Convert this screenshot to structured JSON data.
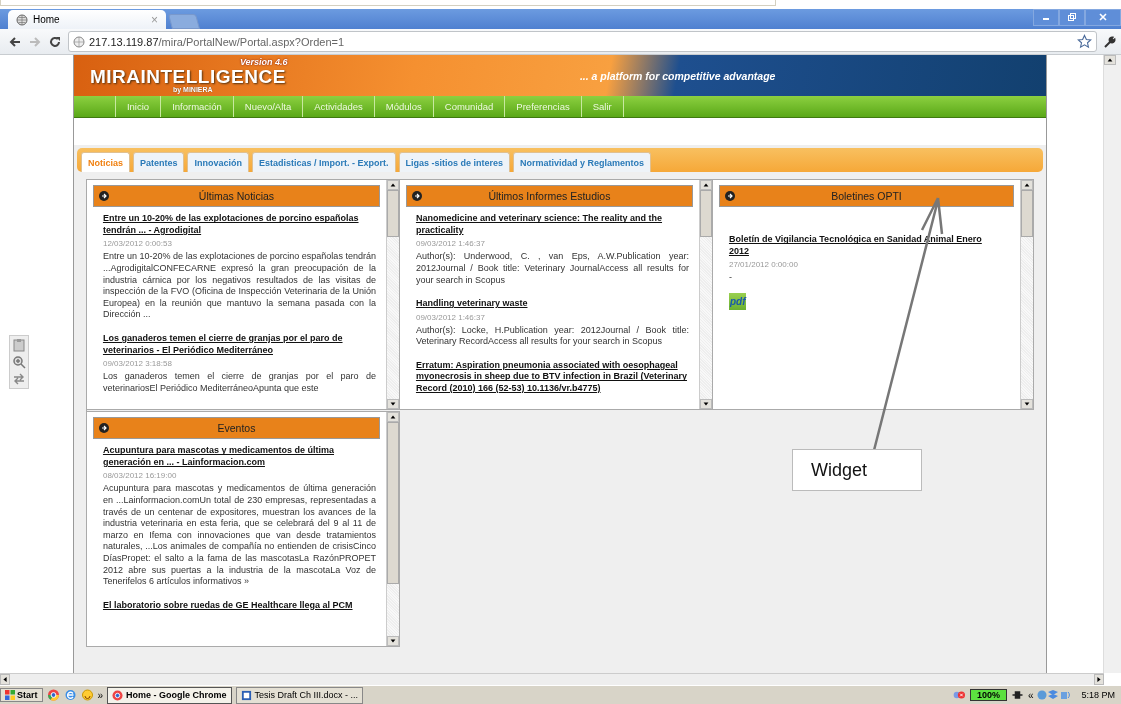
{
  "browser": {
    "tabs": [
      {
        "title": "Home",
        "selected": true
      }
    ],
    "close": "×",
    "url_host": "217.13.119.87",
    "url_path": "/mira/PortalNew/Portal.aspx?Orden=1"
  },
  "site": {
    "logo": "MIRAINTELLIGENCE",
    "version": "Version 4.6",
    "byline": "by MINIERA",
    "tagline": "... a platform for competitive advantage",
    "nav": [
      "Inicio",
      "Información",
      "Nuevo/Alta",
      "Actividades",
      "Módulos",
      "Comunidad",
      "Preferencias",
      "Salir"
    ]
  },
  "tabs": [
    {
      "label": "Noticias",
      "selected": true
    },
    {
      "label": "Patentes",
      "selected": false
    },
    {
      "label": "Innovación",
      "selected": false
    },
    {
      "label": "Estadisticas / Import. - Export.",
      "selected": false
    },
    {
      "label": "Ligas -sitios de interes",
      "selected": false
    },
    {
      "label": "Normatividad y Reglamentos",
      "selected": false
    }
  ],
  "columns": [
    {
      "widgets": [
        {
          "title": "Últimas Noticias",
          "items": [
            {
              "title": "Entre un 10-20% de las explotaciones de porcino españolas tendrán ... - Agrodigital",
              "date": "12/03/2012 0:00:53",
              "body": "Entre un 10-20% de las explotaciones de porcino españolas tendrán ...AgrodigitalCONFECARNE expresó la gran preocupación de la industria cárnica por los negativos resultados de las visitas de inspección de la FVO (Oficina de Inspección Veterinaria de la Unión Europea) en la reunión que mantuvo la semana pasada con la Dirección ..."
            },
            {
              "title": "Los ganaderos temen el cierre de granjas por el paro de veterinarios - El Periódico Mediterráneo",
              "date": "09/03/2012 3:18:58",
              "body": "Los ganaderos temen el cierre de granjas por el paro de veterinariosEl Periódico MediterráneoApunta que este"
            }
          ]
        },
        {
          "title": "Eventos",
          "items": [
            {
              "title": "Acupuntura para mascotas y medicamentos de última generación en ... - Lainformacion.com",
              "date": "08/03/2012 16:19:00",
              "body": "Acupuntura para mascotas y medicamentos de última generación en ...Lainformacion.comUn total de 230 empresas, representadas a través de un centenar de expositores, muestran los avances de la industria veterinaria en esta feria, que se celebrará del 9 al 11 de marzo en Ifema con innovaciones que van desde tratamientos naturales, ...Los animales de compañía no entienden de crisisCinco DíasPropet: el salto a la fama de las mascotasLa RazónPROPET 2012 abre sus puertas a la industria de la mascotaLa Voz de Tenerifelos 6 artículos informativos »"
            },
            {
              "title": "El laboratorio sobre ruedas de GE Healthcare llega al PCM"
            }
          ]
        }
      ]
    },
    {
      "widgets": [
        {
          "title": "Últimos Informes Estudios",
          "items": [
            {
              "title": "Nanomedicine and veterinary science: The reality and the practicality",
              "date": "09/03/2012 1:46:37",
              "body": "Author(s): Underwood, C. , van Eps, A.W.Publication year: 2012Journal / Book title: Veterinary JournalAccess all results for your search in Scopus"
            },
            {
              "title": "Handling veterinary waste",
              "date": "09/03/2012 1:46:37",
              "body": "Author(s): Locke, H.Publication year: 2012Journal / Book title: Veterinary RecordAccess all results for your search in Scopus"
            },
            {
              "title": "Erratum: Aspiration pneumonia associated with oesophageal myonecrosis in sheep due to BTV infection in Brazil (Veterinary Record (2010) 166 (52-53) 10.1136/vr.b4775)"
            }
          ]
        }
      ]
    },
    {
      "widgets": [
        {
          "title": "Boletines OPTI",
          "items": [
            {
              "title": "Boletín de Vigilancia Tecnológica en Sanidad Animal Enero 2012",
              "date": "27/01/2012 0:00:00",
              "body": "-",
              "attachment": "pdf"
            }
          ]
        }
      ]
    }
  ],
  "annotation": {
    "label": "Widget"
  },
  "taskbar": {
    "start": "Start",
    "more": "»",
    "items": [
      {
        "title": "Home - Google Chrome",
        "selected": true
      },
      {
        "title": "Tesis Draft Ch III.docx - ...",
        "selected": false
      }
    ],
    "battery": "100%",
    "tray_more": "«",
    "clock": "5:18 PM"
  }
}
